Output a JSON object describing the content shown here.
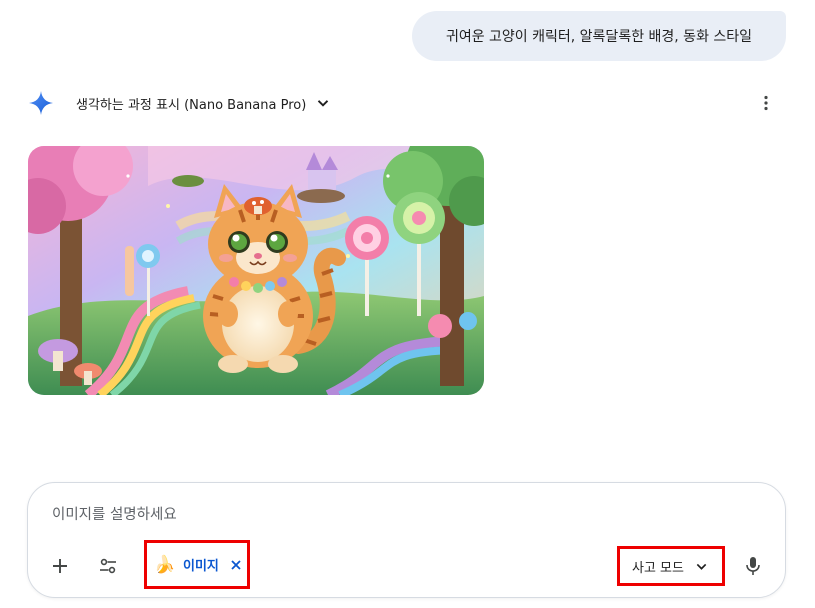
{
  "conversation": {
    "user_message": "귀여운 고양이 캐릭터, 알록달록한 배경, 동화 스타일"
  },
  "response": {
    "thinking_label": "생각하는 과정 표시 (Nano Banana Pro)",
    "image_icon": "generated-image"
  },
  "composer": {
    "placeholder": "이미지를 설명하세요",
    "value": "",
    "chip": {
      "emoji": "🍌",
      "label": "이미지"
    },
    "mode_label": "사고 모드"
  },
  "colors": {
    "accent": "#0b57d0",
    "bubble": "#e9eef6",
    "highlight": "#ee0000"
  },
  "icons": [
    "spark-icon",
    "chevron-down-icon",
    "more-vert-icon",
    "plus-icon",
    "tools-icon",
    "close-icon",
    "mic-icon"
  ]
}
